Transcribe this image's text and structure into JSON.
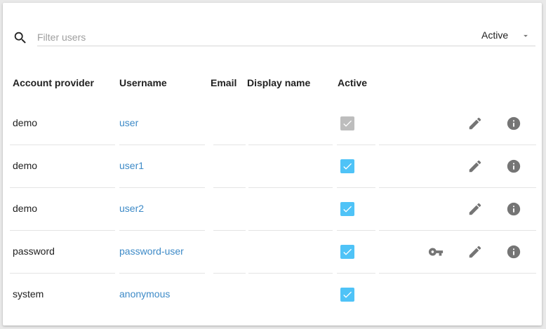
{
  "filter": {
    "placeholder": "Filter users",
    "value": "",
    "status_selected": "Active"
  },
  "table": {
    "headers": {
      "provider": "Account provider",
      "username": "Username",
      "email": "Email",
      "display_name": "Display name",
      "active": "Active"
    },
    "rows": [
      {
        "provider": "demo",
        "username": "user",
        "email": "",
        "display_name": "",
        "active": true,
        "active_editable": false,
        "has_key": false,
        "has_edit": true,
        "has_info": true
      },
      {
        "provider": "demo",
        "username": "user1",
        "email": "",
        "display_name": "",
        "active": true,
        "active_editable": true,
        "has_key": false,
        "has_edit": true,
        "has_info": true
      },
      {
        "provider": "demo",
        "username": "user2",
        "email": "",
        "display_name": "",
        "active": true,
        "active_editable": true,
        "has_key": false,
        "has_edit": true,
        "has_info": true
      },
      {
        "provider": "password",
        "username": "password-user",
        "email": "",
        "display_name": "",
        "active": true,
        "active_editable": true,
        "has_key": true,
        "has_edit": true,
        "has_info": true
      },
      {
        "provider": "system",
        "username": "anonymous",
        "email": "",
        "display_name": "",
        "active": true,
        "active_editable": true,
        "has_key": false,
        "has_edit": false,
        "has_info": false
      }
    ],
    "row_icons": {
      "key": "key-icon",
      "edit": "pencil-icon",
      "info": "info-icon"
    }
  },
  "colors": {
    "link": "#3d8ac7",
    "checkbox_active": "#4fc3f7",
    "checkbox_disabled": "#bdbdbd",
    "icon": "#757575"
  }
}
